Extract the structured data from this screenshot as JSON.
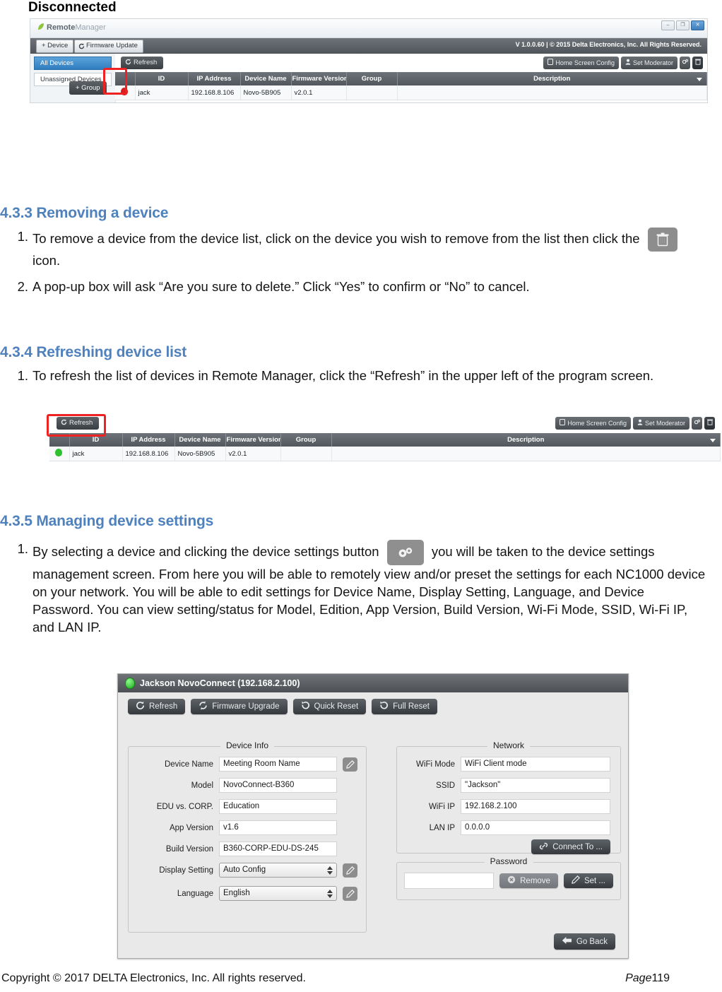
{
  "page": {
    "disconnected_caption": "Disconnected",
    "footer_copyright": "Copyright © 2017 DELTA Electronics, Inc. All rights reserved.",
    "footer_page_label": "Page",
    "footer_page_number": "119",
    "heading_color": "#4F81BD"
  },
  "sections": [
    {
      "heading": "4.3.3 Removing a device",
      "steps": [
        {
          "num": "1.",
          "text_before": "To remove a device from the device list, click on the device you wish to remove from the list then click the",
          "icon": "trash-icon",
          "text_after": "icon."
        },
        {
          "num": "2.",
          "text": "A pop-up box will ask “Are you sure to delete.” Click “Yes” to confirm or “No” to cancel."
        }
      ]
    },
    {
      "heading": "4.3.4 Refreshing device list",
      "steps": [
        {
          "num": "1.",
          "text": "To refresh the list of devices in Remote Manager, click the “Refresh” in the upper left of the program screen."
        }
      ]
    },
    {
      "heading": "4.3.5 Managing device settings",
      "steps": [
        {
          "num": "1.",
          "text_before": "By selecting a device and clicking the device settings button",
          "icon": "gears-icon",
          "text_after": "you will be taken to the device settings management screen. From here you will be able to remotely view and/or preset the settings for each NC1000 device on your network. You will be able to edit settings for Device Name, Display Setting, Language, and Device Password. You can view setting/status for Model, Edition, App Version, Build Version, Wi-Fi Mode, SSID, Wi-Fi IP, and LAN IP."
        }
      ]
    }
  ],
  "remote_manager": {
    "app_name_bold": "Remote",
    "app_name_light": "Manager",
    "menu_buttons": [
      {
        "label": "+ Device",
        "name": "add-device-button"
      },
      {
        "label": "Firmware Update",
        "name": "firmware-update-button"
      }
    ],
    "version_text": "V 1.0.0.60  |  © 2015 Delta Electronics, Inc. All Rights Reserved.",
    "window_buttons": [
      "–",
      "❐",
      "✕"
    ],
    "sidebar": [
      {
        "label": "All Devices",
        "active": true
      },
      {
        "label": "Unassigned Devices",
        "active": false
      }
    ],
    "group_button": "+ Group",
    "refresh_button": "Refresh",
    "toolbar_right": [
      {
        "label": "Home Screen Config",
        "name": "home-screen-config-button"
      },
      {
        "label": "Set Moderator",
        "name": "set-moderator-button"
      },
      {
        "label": "",
        "name": "settings-gear-button"
      },
      {
        "label": "",
        "name": "delete-trash-button"
      }
    ],
    "columns": [
      "",
      "ID",
      "IP Address",
      "Device Name",
      "Firmware Version",
      "Group",
      "Description"
    ],
    "row_disconnected": {
      "status": "disconnected",
      "id": "jack",
      "ip": "192.168.8.106",
      "device_name": "Novo-5B905",
      "firmware": "v2.0.1",
      "group": "",
      "description": ""
    },
    "row_connected": {
      "status": "connected",
      "id": "jack",
      "ip": "192.168.8.106",
      "device_name": "Novo-5B905",
      "firmware": "v2.0.1",
      "group": "",
      "description": ""
    }
  },
  "device_settings_dialog": {
    "title": "Jackson NovoConnect (192.168.2.100)",
    "toolbar": [
      {
        "label": "Refresh",
        "icon": "refresh-icon"
      },
      {
        "label": "Firmware Upgrade",
        "icon": "firmware-icon"
      },
      {
        "label": "Quick Reset",
        "icon": "reset-icon"
      },
      {
        "label": "Full Reset",
        "icon": "reset-icon"
      }
    ],
    "device_info": {
      "legend": "Device Info",
      "fields": [
        {
          "label": "Device Name",
          "value": "Meeting Room Name",
          "type": "text",
          "editable": true
        },
        {
          "label": "Model",
          "value": "NovoConnect-B360",
          "type": "text",
          "editable": false
        },
        {
          "label": "EDU vs. CORP.",
          "value": "Education",
          "type": "text",
          "editable": false
        },
        {
          "label": "App Version",
          "value": "v1.6",
          "type": "text",
          "editable": false
        },
        {
          "label": "Build Version",
          "value": "B360-CORP-EDU-DS-245",
          "type": "text",
          "editable": false
        },
        {
          "label": "Display Setting",
          "value": "Auto Config",
          "type": "combo",
          "editable": true
        },
        {
          "label": "Language",
          "value": "English",
          "type": "combo",
          "editable": true
        }
      ]
    },
    "network": {
      "legend": "Network",
      "fields": [
        {
          "label": "WiFi Mode",
          "value": "WiFi Client mode"
        },
        {
          "label": "SSID",
          "value": "\"Jackson\""
        },
        {
          "label": "WiFi IP",
          "value": "192.168.2.100"
        },
        {
          "label": "LAN IP",
          "value": "0.0.0.0"
        }
      ],
      "connect_button": "Connect To ..."
    },
    "password": {
      "legend": "Password",
      "value": "",
      "remove_button": "Remove",
      "set_button": "Set ..."
    },
    "go_back_button": "Go Back"
  }
}
